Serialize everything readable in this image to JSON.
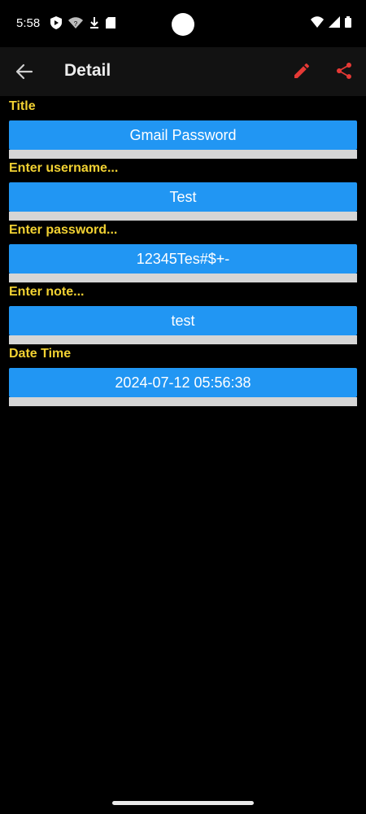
{
  "status_bar": {
    "time": "5:58",
    "left_icons": [
      "shield-play-icon",
      "wifi-question-icon",
      "download-icon",
      "sd-card-icon"
    ],
    "right_icons": [
      "wifi-icon",
      "signal-icon",
      "battery-icon"
    ]
  },
  "app_bar": {
    "title": "Detail",
    "icons": {
      "back": "arrow-left-icon",
      "edit": "pencil-icon",
      "share": "share-icon"
    },
    "accent_color": "#e53935"
  },
  "form": {
    "label_color": "#f1d132",
    "box_color": "#2196f3",
    "fields": [
      {
        "label": "Title",
        "value": "Gmail Password"
      },
      {
        "label": "Enter username...",
        "value": "Test"
      },
      {
        "label": "Enter password...",
        "value": "12345Tes#$+-"
      },
      {
        "label": "Enter note...",
        "value": "test"
      },
      {
        "label": "Date Time",
        "value": "2024-07-12 05:56:38"
      }
    ]
  }
}
